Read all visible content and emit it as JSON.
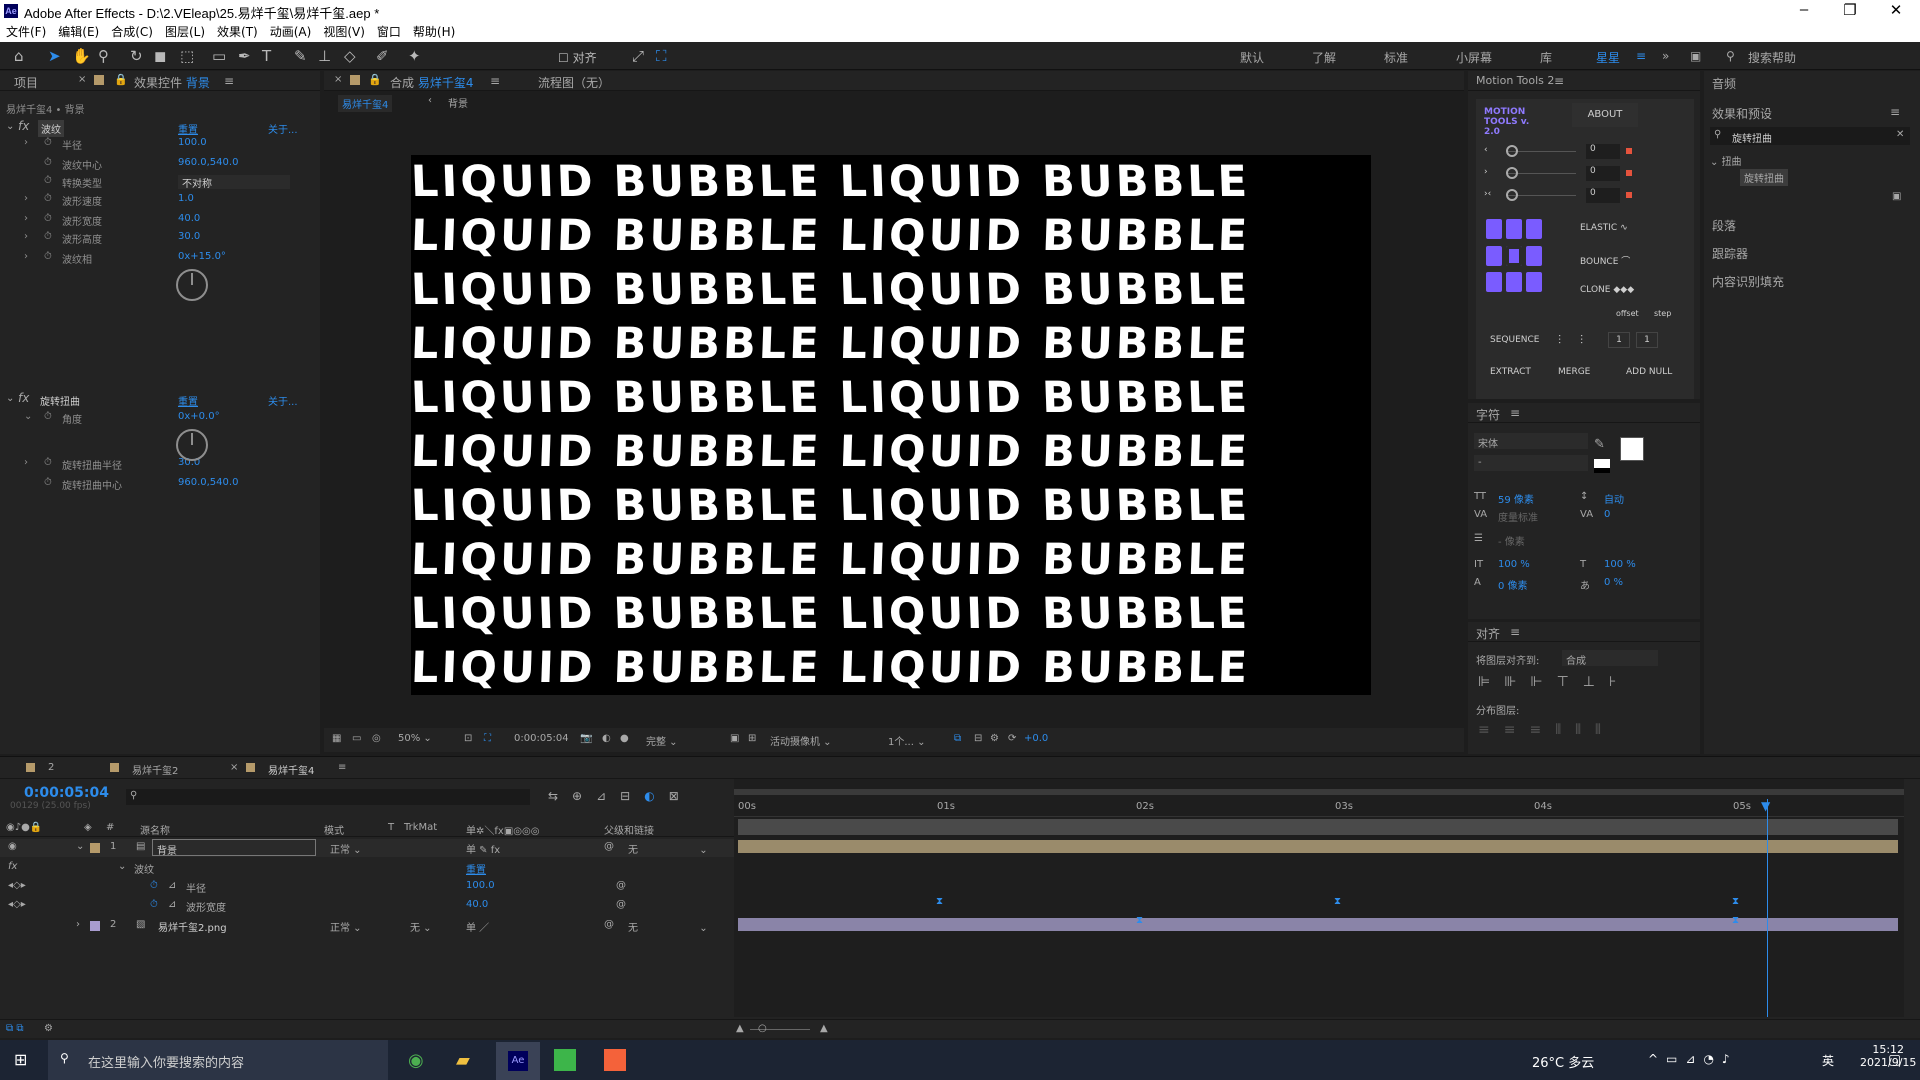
{
  "window": {
    "title": "Adobe After Effects - D:\\2.VEleap\\25.易烊千玺\\易烊千玺.aep *",
    "app_icon": "Ae"
  },
  "menu": [
    "文件(F)",
    "编辑(E)",
    "合成(C)",
    "图层(L)",
    "效果(T)",
    "动画(A)",
    "视图(V)",
    "窗口",
    "帮助(H)"
  ],
  "toolbar": {
    "align_label": "对齐",
    "workspaces": [
      "默认",
      "了解",
      "标准",
      "小屏幕",
      "库",
      "星星"
    ],
    "search_placeholder": "搜索帮助"
  },
  "left_panel": {
    "tab_project": "项目",
    "tab_effects": "效果控件",
    "tab_effects_layer": "背景",
    "breadcrumb": "易烊千玺4 • 背景",
    "wave": {
      "name": "波纹",
      "reset": "重置",
      "about": "关于...",
      "props": [
        {
          "label": "半径",
          "value": "100.0"
        },
        {
          "label": "波纹中心",
          "value": "960.0,540.0"
        },
        {
          "label": "转换类型",
          "value": "不对称"
        },
        {
          "label": "波形速度",
          "value": "1.0"
        },
        {
          "label": "波形宽度",
          "value": "40.0"
        },
        {
          "label": "波形高度",
          "value": "30.0"
        },
        {
          "label": "波纹相",
          "value": "0x+15.0°"
        }
      ]
    },
    "twirl": {
      "name": "旋转扭曲",
      "reset": "重置",
      "about": "关于...",
      "props": [
        {
          "label": "角度",
          "value": "0x+0.0°"
        },
        {
          "label": "旋转扭曲半径",
          "value": "30.0"
        },
        {
          "label": "旋转扭曲中心",
          "value": "960.0,540.0"
        }
      ]
    }
  },
  "comp_panel": {
    "tab_label": "合成",
    "tab_name": "易烊千玺4",
    "flow": "流程图（无）",
    "sub_tabs": [
      "易烊千玺4",
      "背景"
    ],
    "canvas_text": "LIQUID BUBBLE LIQUID BUBBLE",
    "footer": {
      "zoom": "50%",
      "time": "0:00:05:04",
      "quality": "完整",
      "camera": "活动摄像机",
      "views": "1个...",
      "exposure": "+0.0"
    }
  },
  "motion_tools": {
    "title": "Motion Tools 2",
    "logo": "MOTION TOOLS v. 2.0",
    "about": "ABOUT",
    "sliders": [
      "0",
      "0",
      "0"
    ],
    "elastic": "ELASTIC",
    "bounce": "BOUNCE",
    "clone": "CLONE",
    "offset": "offset",
    "step": "step",
    "sequence": "SEQUENCE",
    "seq_vals": [
      "1",
      "1"
    ],
    "extract": "EXTRACT",
    "merge": "MERGE",
    "add_null": "ADD NULL"
  },
  "char_panel": {
    "title": "字符",
    "font": "宋体",
    "style": "-",
    "size": "59 像素",
    "leading": "自动",
    "kerning": "度量标准",
    "tracking": "0",
    "stroke": "- 像素",
    "vscale": "100 %",
    "hscale": "100 %",
    "baseline": "0 像素",
    "tsume": "0 %"
  },
  "align_panel": {
    "title": "对齐",
    "align_to_label": "将图层对齐到:",
    "align_to": "合成",
    "distribute": "分布图层:"
  },
  "right_panel": {
    "audio": "音频",
    "effects_presets": "效果和预设",
    "search_value": "旋转扭曲",
    "category": "扭曲",
    "item": "旋转扭曲",
    "paragraph": "段落",
    "tracker": "跟踪器",
    "content_fill": "内容识别填充"
  },
  "timeline": {
    "tabs": [
      "2",
      "易烊千玺2",
      "易烊千玺4"
    ],
    "timecode": "0:00:05:04",
    "frames": "00129 (25.00 fps)",
    "headers": [
      "源名称",
      "模式",
      "T",
      "TrkMat",
      "父级和链接"
    ],
    "ruler": [
      "00s",
      "01s",
      "02s",
      "03s",
      "04s",
      "05s"
    ],
    "layers": [
      {
        "num": "1",
        "name": "背景",
        "mode": "正常",
        "parent": "无"
      },
      {
        "num": "2",
        "name": "易烊千玺2.png",
        "mode": "正常",
        "trkmat": "无",
        "parent": "无"
      }
    ],
    "effect_group": "波纹",
    "reset": "重置",
    "sub_props": [
      {
        "label": "半径",
        "value": "100.0"
      },
      {
        "label": "波形宽度",
        "value": "40.0"
      }
    ]
  },
  "taskbar": {
    "search": "在这里输入你要搜索的内容",
    "weather": "26°C 多云",
    "time": "15:12",
    "date": "2021/9/15",
    "ime": "英"
  }
}
